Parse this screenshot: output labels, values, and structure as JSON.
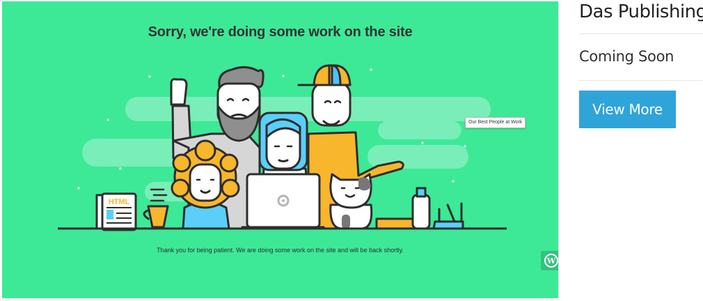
{
  "preview": {
    "headline": "Sorry, we're doing some work on the site",
    "message": "Thank you for being patient. We are doing some work on the site and will be back shortly.",
    "tooltip": "Our Best People at Work",
    "book_label": "HTML",
    "wp_icon": "wordpress-icon",
    "background_color": "#3de897"
  },
  "sidebar": {
    "site_name": "Das Publishing",
    "status": "Coming Soon",
    "view_more_label": "View More",
    "button_color": "#2fa4d8"
  }
}
